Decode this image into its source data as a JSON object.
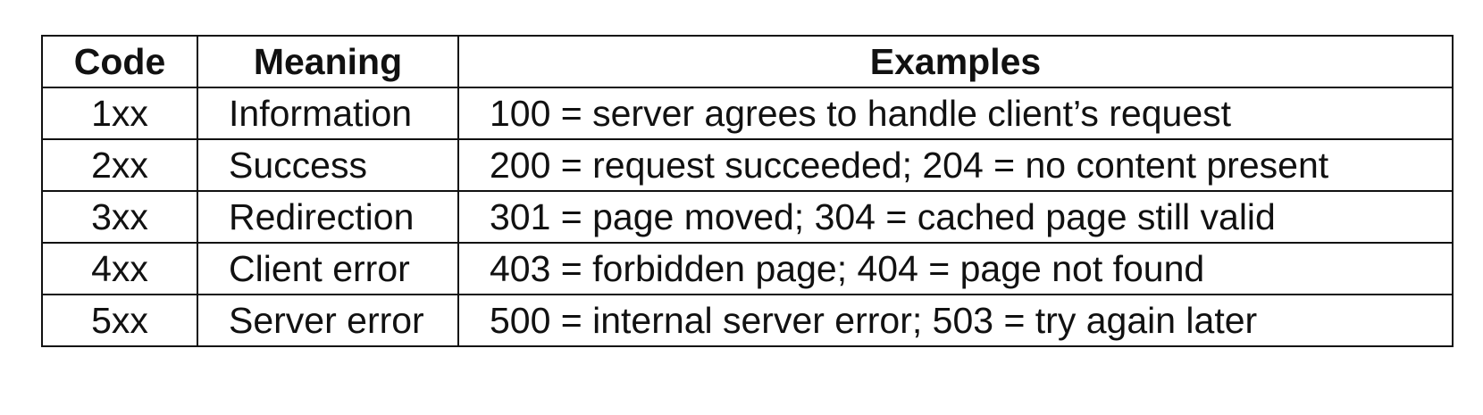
{
  "table": {
    "headers": {
      "code": "Code",
      "meaning": "Meaning",
      "examples": "Examples"
    },
    "rows": [
      {
        "code": "1xx",
        "meaning": "Information",
        "examples": "100 = server agrees to handle client’s request"
      },
      {
        "code": "2xx",
        "meaning": "Success",
        "examples": "200 = request succeeded; 204 = no content present"
      },
      {
        "code": "3xx",
        "meaning": "Redirection",
        "examples": "301 = page moved; 304 = cached page still valid"
      },
      {
        "code": "4xx",
        "meaning": "Client error",
        "examples": "403 = forbidden page; 404 = page not found"
      },
      {
        "code": "5xx",
        "meaning": "Server error",
        "examples": "500 = internal server error; 503 = try again later"
      }
    ]
  }
}
